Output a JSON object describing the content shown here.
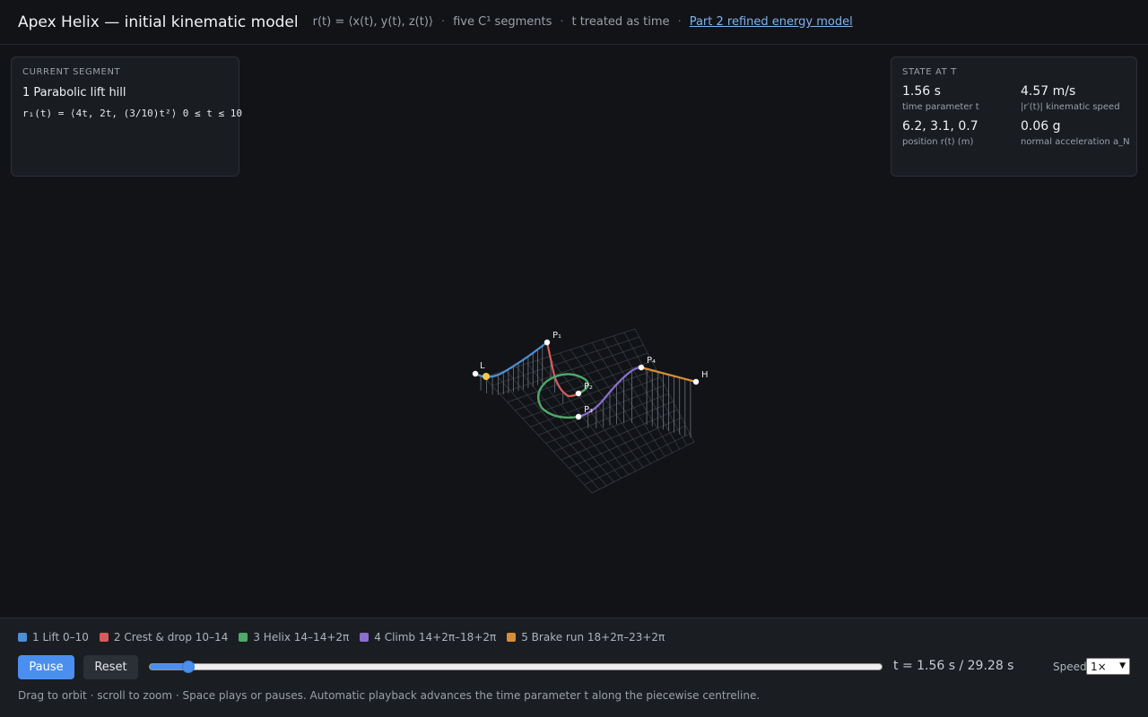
{
  "header": {
    "title": "Apex Helix — initial kinematic model",
    "param": "r(t) = ⟨x(t), y(t), z(t)⟩",
    "sep": "·",
    "segments_note": "five C¹ segments",
    "time_note": "t treated as time",
    "link": "Part 2 refined energy model"
  },
  "segment_panel": {
    "label": "CURRENT SEGMENT",
    "name": "1 Parabolic lift hill",
    "equation": "r₁(t) = ⟨4t, 2t, (3/10)t²⟩ 0 ≤ t ≤ 10"
  },
  "state_panel": {
    "label": "STATE AT T",
    "time": {
      "value": "1.56 s",
      "label": "time parameter t"
    },
    "speed": {
      "value": "4.57 m/s",
      "label": "|r′(t)| kinematic speed"
    },
    "position": {
      "value": "6.2, 3.1, 0.7",
      "label": "position r(t) (m)"
    },
    "accel": {
      "value": "0.06 g",
      "label": "normal acceleration a_N"
    }
  },
  "scene": {
    "labels": {
      "L": "L",
      "P1": "P₁",
      "P2": "P₂",
      "P3": "P₃",
      "P4": "P₄",
      "H": "H"
    },
    "colors": {
      "lift": "#4d8fd4",
      "drop": "#d45c5c",
      "helix": "#4ea96a",
      "climb": "#8a6fd0",
      "brake": "#d88d3a",
      "cart": "#f2c84b",
      "grid": "#3a3f47",
      "support": "#6c727b"
    }
  },
  "legend": [
    {
      "label": "1 Lift 0–10",
      "color": "#4d8fd4"
    },
    {
      "label": "2 Crest & drop 10–14",
      "color": "#d45c5c"
    },
    {
      "label": "3 Helix 14–14+2π",
      "color": "#4ea96a"
    },
    {
      "label": "4 Climb 14+2π–18+2π",
      "color": "#8a6fd0"
    },
    {
      "label": "5 Brake run 18+2π–23+2π",
      "color": "#d88d3a"
    }
  ],
  "controls": {
    "play_label": "Pause",
    "reset_label": "Reset",
    "t_current": 1.56,
    "t_total": 29.28,
    "readout": "t = 1.56 s / 29.28 s",
    "speed_label": "Speed",
    "speed_value": "1×"
  },
  "help_text": "Drag to orbit · scroll to zoom · Space plays or pauses. Automatic playback advances the time parameter t along the piecewise centreline."
}
